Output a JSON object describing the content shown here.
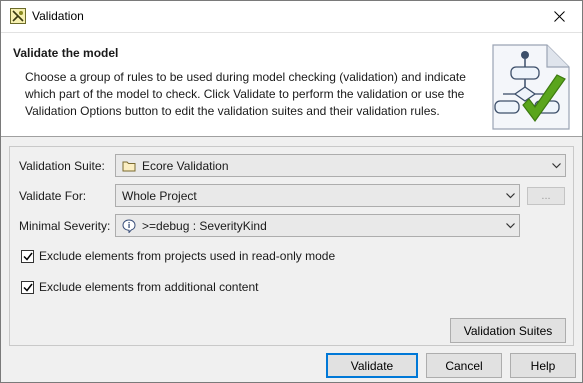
{
  "window": {
    "title": "Validation"
  },
  "header": {
    "title": "Validate the model",
    "description": "Choose a group of rules to be used during model checking (validation) and indicate which part of the model to check. Click Validate to perform the validation or use the Validation Options button to edit the validation suites and their validation rules."
  },
  "form": {
    "suite_label": "Validation Suite:",
    "suite_value": "Ecore Validation",
    "validate_for_label": "Validate For:",
    "validate_for_value": "Whole Project",
    "ellipsis_label": "...",
    "severity_label": "Minimal Severity:",
    "severity_value": ">=debug : SeverityKind",
    "exclude_readonly_label": "Exclude elements from projects used in read-only mode",
    "exclude_readonly_checked": true,
    "exclude_additional_label": "Exclude elements from additional content",
    "exclude_additional_checked": true,
    "suites_button": "Validation Suites"
  },
  "footer": {
    "validate_button": "Validate",
    "cancel_button": "Cancel",
    "help_button": "Help"
  },
  "colors": {
    "accent": "#0078d7",
    "check_green": "#5aa51c"
  }
}
